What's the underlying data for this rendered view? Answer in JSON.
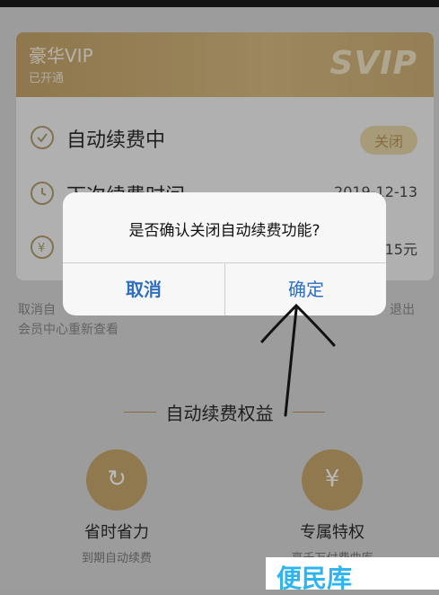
{
  "card": {
    "title": "豪华VIP",
    "subtitle": "已开通",
    "badge": "SVIP",
    "rows": [
      {
        "label": "自动续费中",
        "value": "",
        "action": "关闭",
        "icon": "check-circle-icon"
      },
      {
        "label": "下次续费时间",
        "value": "2019-12-13",
        "icon": "clock-icon"
      },
      {
        "label": "",
        "value": "15元",
        "icon": "yen-circle-icon"
      }
    ]
  },
  "note": {
    "part1": "取消自",
    "part2": "退出",
    "line2": "会员中心重新查看"
  },
  "benefits": {
    "title": "自动续费权益",
    "items": [
      {
        "name": "省时省力",
        "desc": "到期自动续费",
        "icon": "refresh-icon"
      },
      {
        "name": "专属特权",
        "desc": "享千万付费曲库",
        "icon": "yen-icon"
      }
    ]
  },
  "dialog": {
    "message": "是否确认关闭自动续费功能?",
    "cancel_label": "取消",
    "confirm_label": "确定"
  },
  "watermark": {
    "text": "便民库"
  },
  "colors": {
    "gold": "#c9a86e",
    "button_blue": "#2f6fbf"
  }
}
